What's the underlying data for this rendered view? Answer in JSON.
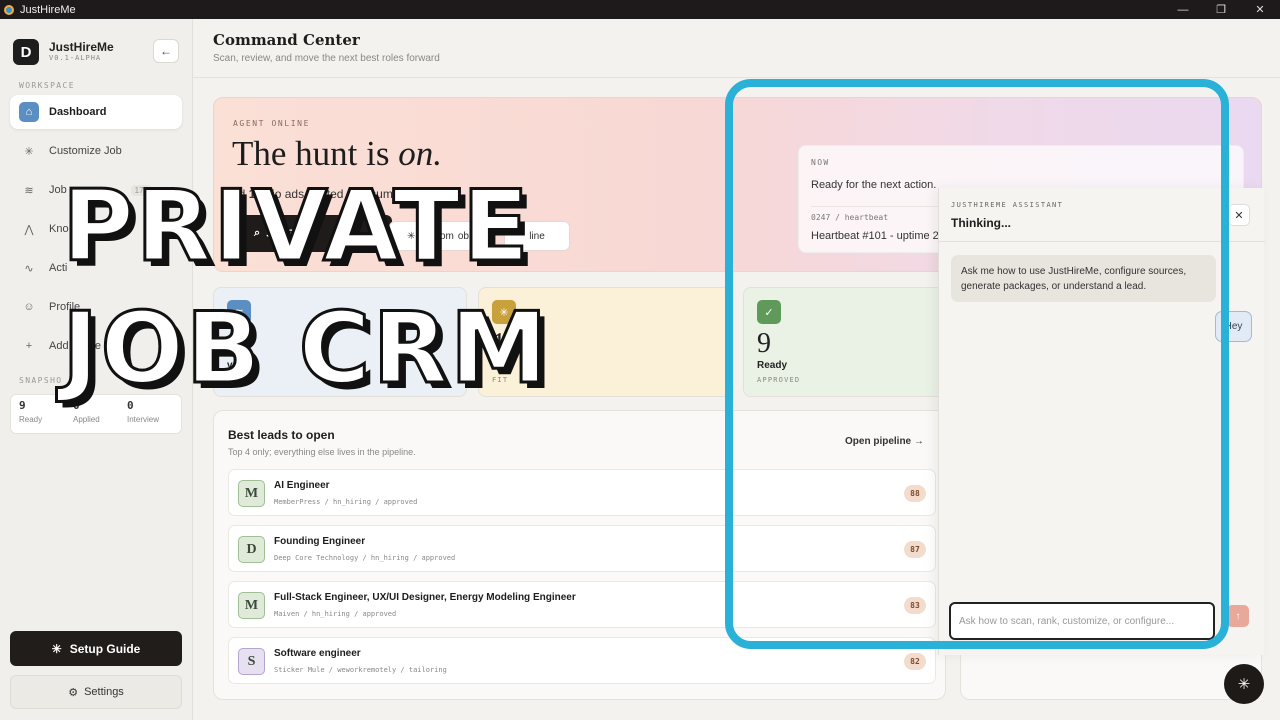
{
  "window": {
    "title": "JustHireMe",
    "controls": [
      "—",
      "❐",
      "✕"
    ]
  },
  "sidebar": {
    "brand": {
      "name": "JustHireMe",
      "version": "V0.1-ALPHA",
      "logo": "D"
    },
    "collapse_icon": "←",
    "workspace_label": "WORKSPACE",
    "items": [
      {
        "label": "Dashboard",
        "icon": "⌂",
        "icon_name": "home-icon",
        "active": true
      },
      {
        "label": "Customize Job",
        "icon": "✳",
        "icon_name": "sparkle-icon"
      },
      {
        "label": "Job",
        "icon": "≋",
        "icon_name": "layers-icon",
        "count": "170"
      },
      {
        "label": "Kno",
        "icon": "⋀",
        "icon_name": "knowledge-icon"
      },
      {
        "label": "Acti",
        "icon": "∿",
        "icon_name": "activity-icon"
      },
      {
        "label": "Profile",
        "icon": "☺",
        "icon_name": "user-icon"
      },
      {
        "label": "Add Conte",
        "icon": "+",
        "icon_name": "plus-icon"
      }
    ],
    "snapshot_label": "SNAPSHO",
    "snapshot": [
      {
        "value": "9",
        "label": "Ready"
      },
      {
        "value": "0",
        "label": "Applied"
      },
      {
        "value": "0",
        "label": "Interview"
      }
    ],
    "setup_label": "Setup Guide",
    "settings_label": "Settings"
  },
  "header": {
    "title": "Command Center",
    "subtitle": "Scan, review, and move the next best roles forward"
  },
  "hero": {
    "status": "AGENT ONLINE",
    "title_main": "The hunt is ",
    "title_em": "on.",
    "desc_a": "nd ",
    "desc_b": "170",
    "desc_c": " jo",
    "desc_d": " ads, c",
    "desc_e": " ated ",
    "desc_f": "1",
    "desc_g": " t",
    "desc_h": " esumes.",
    "run_label": "S",
    "run_label_b": "URC",
    "customize_label": "Custom",
    "customize_tail": "ob",
    "pipeline_label": "line",
    "now": {
      "label": "NOW",
      "text": "Ready for the next action.",
      "hb_id": "0247 / heartbeat",
      "hb_text": "Heartbeat #101 - uptime 21"
    }
  },
  "stats": [
    {
      "num": "",
      "label": "ve lea",
      "sub": "",
      "color": "#5b8ec2",
      "bg": "#eaf0f6"
    },
    {
      "num": "12",
      "label": "Sco",
      "sub": "FIT",
      "color": "#c9a13c",
      "bg": "#fbf1d8"
    },
    {
      "num": "9",
      "label": "Ready",
      "sub": "APPROVED",
      "color": "#5f9a5a",
      "bg": "#eaf2e6"
    }
  ],
  "leads": {
    "title": "Best leads to open",
    "subtitle": "Top 4 only; everything else lives in the pipeline.",
    "open_label": "Open pipeline →",
    "rows": [
      {
        "initial": "M",
        "title": "AI Engineer",
        "meta": "MemberPress / hn_hiring / approved",
        "score": "88",
        "bg": "#dfead8"
      },
      {
        "initial": "D",
        "title": "Founding Engineer",
        "meta": "Deep Core Technology / hn_hiring / approved",
        "score": "87",
        "bg": "#dfead8"
      },
      {
        "initial": "M",
        "title": "Full-Stack Engineer, UX/UI Designer, Energy Modeling Engineer",
        "meta": "Maiven / hn_hiring / approved",
        "score": "83",
        "bg": "#dfead8"
      },
      {
        "initial": "S",
        "title": "Software engineer",
        "meta": "Sticker Mule / weworkremotely / tailoring",
        "score": "82",
        "bg": "#e6e0f0"
      }
    ]
  },
  "assistant": {
    "label": "JUSTHIREME ASSISTANT",
    "status": "Thinking...",
    "close": "✕",
    "message": "Ask me how to use JustHireMe, configure sources, generate packages, or understand a lead.",
    "user_msg": "Hey",
    "input_placeholder": "Ask how to scan, rank, customize, or configure...",
    "send": "↑"
  },
  "fab_icon": "✳",
  "overlay": {
    "line1": "PRIVATE",
    "line2": "JOB CRM",
    "accent": "#29b1d8"
  }
}
